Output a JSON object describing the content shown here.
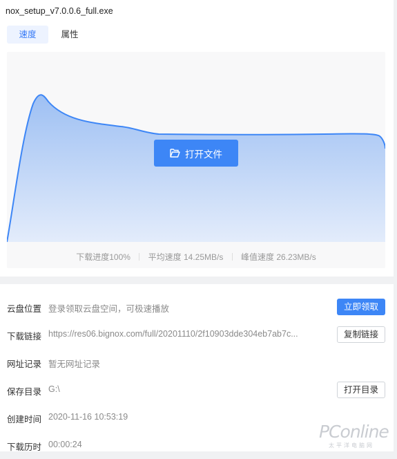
{
  "window": {
    "title": "nox_setup_v7.0.0.6_full.exe"
  },
  "tabs": [
    {
      "label": "速度",
      "active": true
    },
    {
      "label": "属性",
      "active": false
    }
  ],
  "speed_chart": {
    "fill_colors": [
      "#9ec0f3",
      "#e3ecfb"
    ],
    "line_color": "#3d86f6",
    "open_file_label": "打开文件",
    "open_file_icon": "folder-open-icon"
  },
  "stats": {
    "progress": "下载进度100%",
    "average": "平均速度 14.25MB/s",
    "peak": "峰值速度 26.23MB/s"
  },
  "details": {
    "cloud": {
      "label": "云盘位置",
      "value": "登录领取云盘空间，可极速播放",
      "button": "立即领取"
    },
    "link": {
      "label": "下载链接",
      "value": "https://res06.bignox.com/full/20201110/2f10903dde304eb7ab7c...",
      "button": "复制链接"
    },
    "history": {
      "label": "网址记录",
      "value": "暂无网址记录"
    },
    "save_dir": {
      "label": "保存目录",
      "value": "G:\\",
      "button": "打开目录"
    },
    "created": {
      "label": "创建时间",
      "value": "2020-11-16 10:53:19"
    },
    "duration": {
      "label": "下载历时",
      "value": "00:00:24"
    }
  },
  "watermark": {
    "text": "PConline",
    "sub": "太平洋电脑网"
  }
}
